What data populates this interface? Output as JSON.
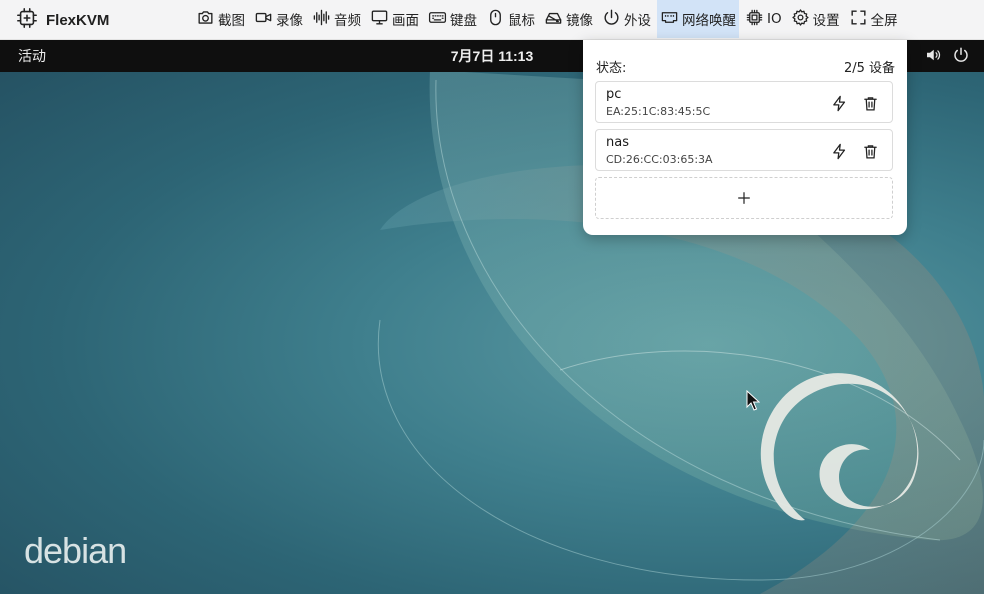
{
  "app": {
    "name": "FlexKVM"
  },
  "menu": [
    {
      "label": "截图",
      "icon": "camera-icon"
    },
    {
      "label": "录像",
      "icon": "video-icon"
    },
    {
      "label": "音频",
      "icon": "audio-wave-icon"
    },
    {
      "label": "画面",
      "icon": "monitor-icon"
    },
    {
      "label": "键盘",
      "icon": "keyboard-icon"
    },
    {
      "label": "鼠标",
      "icon": "mouse-icon"
    },
    {
      "label": "镜像",
      "icon": "disk-drive-icon"
    },
    {
      "label": "外设",
      "icon": "power-icon"
    },
    {
      "label": "网络唤醒",
      "icon": "network-port-icon",
      "active": true
    },
    {
      "label": "IO",
      "icon": "chip-icon"
    },
    {
      "label": "设置",
      "icon": "gear-icon"
    },
    {
      "label": "全屏",
      "icon": "fullscreen-icon"
    }
  ],
  "desktop": {
    "activities": "活动",
    "clock": "7月7日  11:13",
    "logo_text": "debian"
  },
  "wol_panel": {
    "status_label": "状态:",
    "device_count": "2/5 设备",
    "devices": [
      {
        "name": "pc",
        "mac": "EA:25:1C:83:45:5C"
      },
      {
        "name": "nas",
        "mac": "CD:26:CC:03:65:3A"
      }
    ]
  },
  "colors": {
    "toolbar_bg": "#f4f4f5",
    "active_menu_bg": "#d2e3f7",
    "desktop_teal": "#2d6575",
    "gnome_bar": "#0f0f0f"
  }
}
